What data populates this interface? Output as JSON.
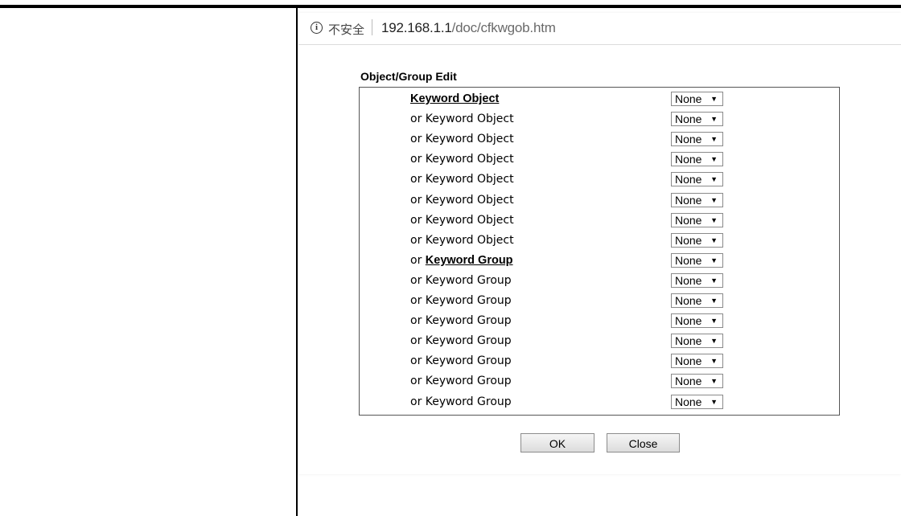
{
  "address_bar": {
    "security_label": "不安全",
    "url_host": "192.168.1.1",
    "url_path": "/doc/cfkwgob.htm"
  },
  "dialog": {
    "title": "Object/Group Edit",
    "rows": [
      {
        "prefix": "",
        "link": "Keyword Object",
        "text": "",
        "value": "None"
      },
      {
        "prefix": "",
        "link": "",
        "text": "or Keyword Object",
        "value": "None"
      },
      {
        "prefix": "",
        "link": "",
        "text": "or Keyword Object",
        "value": "None"
      },
      {
        "prefix": "",
        "link": "",
        "text": "or Keyword Object",
        "value": "None"
      },
      {
        "prefix": "",
        "link": "",
        "text": "or Keyword Object",
        "value": "None"
      },
      {
        "prefix": "",
        "link": "",
        "text": "or Keyword Object",
        "value": "None"
      },
      {
        "prefix": "",
        "link": "",
        "text": "or Keyword Object",
        "value": "None"
      },
      {
        "prefix": "",
        "link": "",
        "text": "or Keyword Object",
        "value": "None"
      },
      {
        "prefix": "or ",
        "link": "Keyword Group",
        "text": "",
        "value": "None"
      },
      {
        "prefix": "",
        "link": "",
        "text": "or Keyword Group",
        "value": "None"
      },
      {
        "prefix": "",
        "link": "",
        "text": "or Keyword Group",
        "value": "None"
      },
      {
        "prefix": "",
        "link": "",
        "text": "or Keyword Group",
        "value": "None"
      },
      {
        "prefix": "",
        "link": "",
        "text": "or Keyword Group",
        "value": "None"
      },
      {
        "prefix": "",
        "link": "",
        "text": "or Keyword Group",
        "value": "None"
      },
      {
        "prefix": "",
        "link": "",
        "text": "or Keyword Group",
        "value": "None"
      },
      {
        "prefix": "",
        "link": "",
        "text": "or Keyword Group",
        "value": "None"
      }
    ],
    "ok_label": "OK",
    "close_label": "Close"
  }
}
